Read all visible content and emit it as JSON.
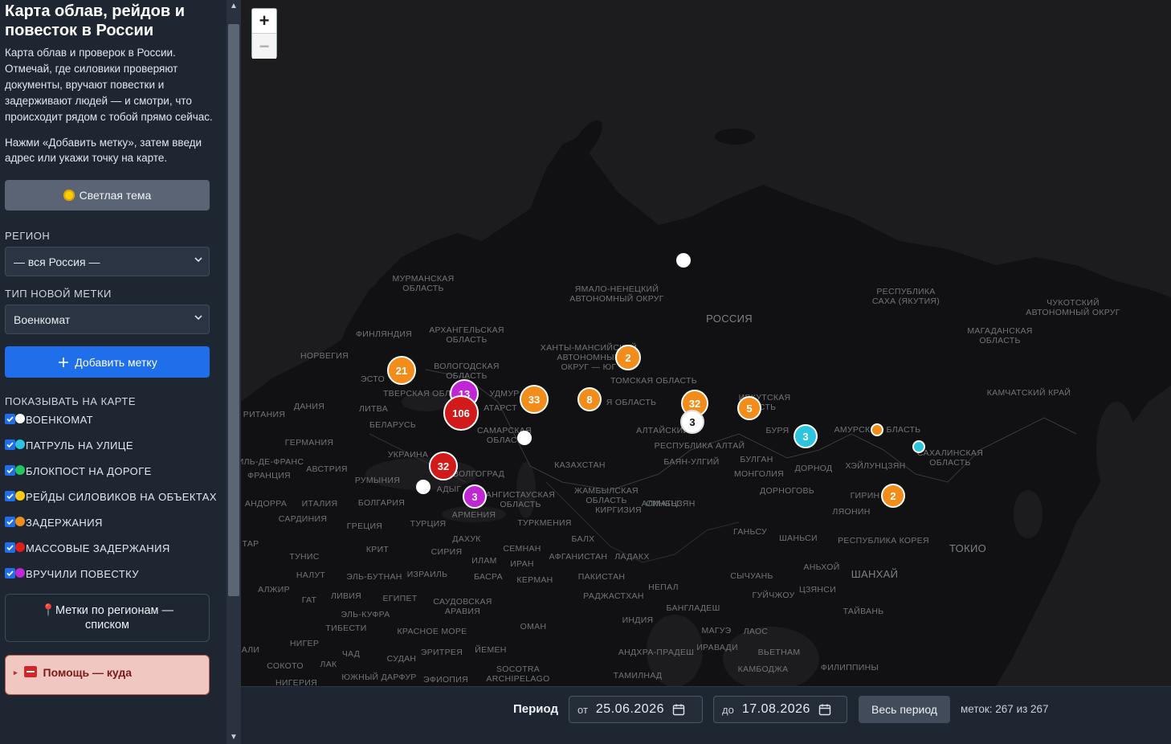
{
  "sidebar": {
    "title": "Карта облав, рейдов и повесток в России",
    "description": "Карта облав и проверок в России. Отмечай, где силовики проверяют документы, вручают повестки и задерживают людей — и смотри, что происходит рядом с тобой прямо сейчас.",
    "instruction": "Нажми «Добавить метку», затем введи адрес или укажи точку на карте.",
    "theme_button": "Светлая тема",
    "region_label": "РЕГИОН",
    "region_value": "— вся Россия —",
    "type_label": "ТИП НОВОЙ МЕТКИ",
    "type_value": "Военкомат",
    "add_button": "Добавить метку",
    "show_label": "ПОКАЗЫВАТЬ НА КАРТЕ",
    "layers": [
      {
        "label": "ВОЕНКОМАТ",
        "color": "#ffffff",
        "checked": true
      },
      {
        "label": "ПАТРУЛЬ НА УЛИЦЕ",
        "color": "#2ec4e0",
        "checked": true
      },
      {
        "label": "БЛОКПОСТ НА ДОРОГЕ",
        "color": "#22c55e",
        "checked": true
      },
      {
        "label": "РЕЙДЫ СИЛОВИКОВ НА ОБЪЕКТАХ",
        "color": "#facc15",
        "checked": true
      },
      {
        "label": "ЗАДЕРЖАНИЯ",
        "color": "#f28c1a",
        "checked": true
      },
      {
        "label": "МАССОВЫЕ ЗАДЕРЖАНИЯ",
        "color": "#e11d1d",
        "checked": true
      },
      {
        "label": "ВРУЧИЛИ ПОВЕСТКУ",
        "color": "#c026d3",
        "checked": true
      }
    ],
    "list_button": "Метки по регионам — списком",
    "help_button": "Помощь — куда"
  },
  "map": {
    "zoom_in": "+",
    "zoom_out": "−",
    "labels": {
      "murmansk": "МУРМАНСКАЯ\nОБЛАСТЬ",
      "yamal": "ЯМАЛО-НЕНЕЦКИЙ\nАВТОНОМНЫЙ ОКРУГ",
      "sakha": "РЕСПУБЛИКА\nСАХА (ЯКУТИЯ)",
      "chukotka": "ЧУКОТСКИЙ\nАВТОНОМНЫЙ ОКРУГ",
      "russia": "РОССИЯ",
      "finland": "ФИНЛЯНДИЯ",
      "arkhangelsk": "АРХАНГЕЛЬСКАЯ\nОБЛАСТЬ",
      "khanty": "ХАНТЫ-МАНСИЙСКИЙ\nАВТОНОМНЫЙ\nОКРУГ — ЮГ",
      "magadan": "МАГАДАНСКАЯ\nОБЛАСТЬ",
      "norway": "НОРВЕГИЯ",
      "vologda": "ВОЛОГОДСКАЯ\nОБЛАСТЬ",
      "tomsk": "ТОМСКАЯ ОБЛАСТЬ",
      "kamchatka": "КАМЧАТСКИЙ КРАЙ",
      "estonia": "ЭСТО",
      "tver": "ТВЕРСКАЯ ОБЛ",
      "udm": "УДМУР",
      "oblast": "Я ОБЛАСТЬ",
      "irkutsk": "ИРКУТСКАЯ\nАСТЬ",
      "denmark": "ДАНИЯ",
      "lithuania": "ЛИТВА",
      "tatar": "АТАРСТ",
      "belarus": "БЕЛАРУСЬ",
      "samara": "САМАРСКАЯ\nОБЛАСТ",
      "altai_krai": "АЛТАЙСКИЙ К",
      "buryat": "БУРЯ",
      "amur": "АМУРСК",
      "oblast2": "БЛАСТЬ",
      "sakhalin": "САХАЛИНСКАЯ\nОБЛАСТЬ",
      "britain": "РИТАНИЯ",
      "germany": "ГЕРМАНИЯ",
      "ukraine": "УКРАИНА",
      "altai_rep": "РЕСПУБЛИКА АЛТАЙ",
      "kazakhstan": "КАЗАХСТАН",
      "ulgii": "БАЯН-УЛГИЙ",
      "bulgan": "БУЛГАН",
      "dornod": "ДОРНОД",
      "heilongjiang": "ХЭЙЛУНЦЗЯН",
      "ile": "ИЛЬ-ДЕ-ФРАНС",
      "austria": "АВСТРИЯ",
      "france": "ФРАНЦИЯ",
      "romania": "РУМЫНИЯ",
      "volgograd": "ВОЛГОГРАД",
      "mongolia": "МОНГОЛИЯ",
      "zhambyl": "ЖАМБЫЛСКАЯ\nОБЛАСТЬ",
      "almaty": "АЛМАТЫ",
      "dornogovi": "ДОРНОГОВЬ",
      "jilin": "ГИРИН",
      "andorra": "АНДОРРА",
      "italy": "ИТАЛИЯ",
      "bulgaria": "БОЛГАРИЯ",
      "adygea": "АДЫГ",
      "astrakhan": "АНГИСТАУСКАЯ\nОБЛАСТЬ",
      "kyrgyzstan": "КИРГИЗИЯ",
      "xinjiang": "СИНЬЦЗЯН",
      "liaoning": "ЛЯОНИН",
      "sardinia": "САРДИНИЯ",
      "greece": "ГРЕЦИЯ",
      "turkey": "ТУРЦИЯ",
      "armenia": "АРМЕНИЯ",
      "turkmenistan": "ТУРКМЕНИЯ",
      "gansu": "ГАНЬСУ",
      "shanxi": "ШАНЬСИ",
      "korea": "РЕСПУБЛИКА КОРЕЯ",
      "tokyo": "ТОКИО",
      "tap": "ТАР",
      "tunisia": "ТУНИС",
      "crete": "КРИТ",
      "syria": "СИРИЯ",
      "dakhuk": "ДАХУК",
      "semnan": "СЕМНАН",
      "balkh": "БАЛХ",
      "afghanistan": "АФГАНИСТАН",
      "ladakh": "ЛАДАКХ",
      "anhui": "АНЬХОЙ",
      "shanghai": "ШАНХАЙ",
      "nalut": "НАЛУТ",
      "elbutnan": "ЭЛЬ-БУТНАН",
      "israel": "ИЗРАИЛЬ",
      "ilam": "ИЛАМ",
      "iran": "ИРАН",
      "basra": "БАСРА",
      "kerman": "КЕРМАН",
      "pakistan": "ПАКИСТАН",
      "sichuan": "СЫЧУАНЬ",
      "zhejiang": "ЦЗЯНСИ",
      "algeria": "АЛЖИР",
      "libya": "ЛИВИЯ",
      "gat": "ГАТ",
      "egypt": "ЕГИПЕТ",
      "saudi": "САУДОВСКАЯ\nАРАВИЯ",
      "rajasthan": "РАДЖАСТХАН",
      "nepal": "НЕПАЛ",
      "guizhou": "ГУЙЧЖОУ",
      "taiwan": "ТАЙВАНЬ",
      "elkufra": "ЭЛЬ-КУФРА",
      "india": "ИНДИЯ",
      "bangladesh": "БАНГЛАДЕШ",
      "tibesti": "ТИБЕСТИ",
      "redsea": "КРАСНОЕ МОРЕ",
      "oman": "ОМАН",
      "magway": "МАГУЭ",
      "laos": "ЛАОС",
      "niger": "НИГЕР",
      "eritrea": "ЭРИТРЕЯ",
      "yemen": "ЙЕМЕН",
      "andhra": "АНДХРА-ПРАДЕШ",
      "ayeyarwady": "ИРАВАДИ",
      "vietnam": "ВЬЕТНАМ",
      "mali": "АЛИ",
      "chad": "ЧАД",
      "sudan": "СУДАН",
      "socotra": "SOCOTRA\nARCHIPELAGO",
      "lake": "ЛАК",
      "sokoto": "СОКОТО",
      "cambodia": "КАМБОДЖА",
      "philippines": "ФИЛИППИНЫ",
      "southdarfur": "ЮЖНЫЙ ДАРФУР",
      "ethiopia": "ЭФИОПИЯ",
      "tamilnadu": "ТАМИЛНАД",
      "nigeria": "НИГЕРИЯ"
    },
    "clusters": [
      {
        "count": "21",
        "color": "#f28c1a"
      },
      {
        "count": "2",
        "color": "#f28c1a"
      },
      {
        "count": "33",
        "color": "#f28c1a"
      },
      {
        "count": "8",
        "color": "#f28c1a"
      },
      {
        "count": "32",
        "color": "#f28c1a"
      },
      {
        "count": "5",
        "color": "#f28c1a"
      },
      {
        "count": "13",
        "color": "#c026d3"
      },
      {
        "count": "106",
        "color": "#d11a1a"
      },
      {
        "count": "32",
        "color": "#d11a1a"
      },
      {
        "count": "3",
        "color": "#c026d3"
      },
      {
        "count": "3",
        "color": "#ffffff"
      },
      {
        "count": "3",
        "color": "#2ec4e0"
      },
      {
        "count": "2",
        "color": "#f28c1a"
      }
    ]
  },
  "period": {
    "label": "Период",
    "from_prefix": "от",
    "from_value": "25.06.2026",
    "to_prefix": "до",
    "to_value": "17.08.2026",
    "all_button": "Весь период",
    "count_text": "меток: 267 из 267"
  }
}
